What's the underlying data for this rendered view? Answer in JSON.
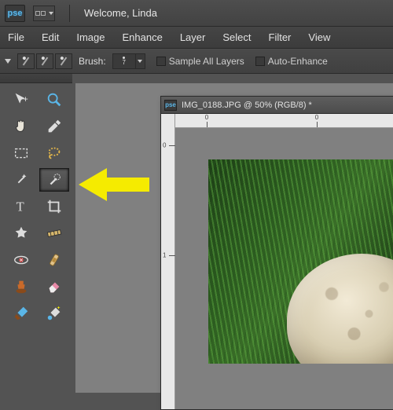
{
  "app": {
    "logo_text": "pse"
  },
  "titlebar": {
    "welcome": "Welcome, Linda"
  },
  "menu": {
    "file": "File",
    "edit": "Edit",
    "image": "Image",
    "enhance": "Enhance",
    "layer": "Layer",
    "select": "Select",
    "filter": "Filter",
    "view": "View"
  },
  "options": {
    "brush_label": "Brush:",
    "brush_size": "7",
    "sample_all": "Sample All Layers",
    "auto_enhance": "Auto-Enhance"
  },
  "tools": [
    {
      "name": "move-tool"
    },
    {
      "name": "zoom-tool"
    },
    {
      "name": "hand-tool"
    },
    {
      "name": "eyedropper-tool"
    },
    {
      "name": "marquee-tool"
    },
    {
      "name": "lasso-tool"
    },
    {
      "name": "magic-wand-tool"
    },
    {
      "name": "quick-selection-tool",
      "selected": true
    },
    {
      "name": "type-tool"
    },
    {
      "name": "crop-tool"
    },
    {
      "name": "cookie-cutter-tool"
    },
    {
      "name": "straighten-tool"
    },
    {
      "name": "red-eye-tool"
    },
    {
      "name": "healing-brush-tool"
    },
    {
      "name": "clone-stamp-tool"
    },
    {
      "name": "eraser-tool"
    },
    {
      "name": "paint-brush-tool"
    },
    {
      "name": "smart-brush-tool"
    }
  ],
  "document": {
    "title": "IMG_0188.JPG @ 50% (RGB/8) *",
    "ruler_h": [
      "0",
      "0"
    ],
    "ruler_v": [
      "0",
      "1"
    ]
  }
}
